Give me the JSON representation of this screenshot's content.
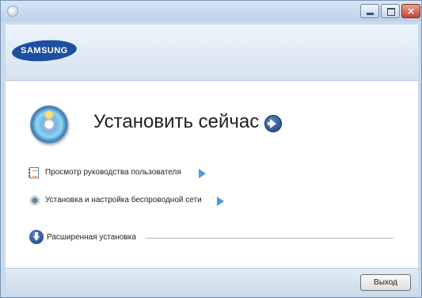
{
  "window": {
    "controls": {
      "close_symbol": "×"
    }
  },
  "header": {
    "logo_text": "SAMSUNG"
  },
  "main": {
    "install_now_label": "Установить сейчас",
    "links": [
      {
        "label": "Просмотр руководства пользователя",
        "icon": "document-icon"
      },
      {
        "label": "Установка и настройка беспроводной сети",
        "icon": "wireless-network-icon"
      }
    ],
    "advanced_label": "Расширенная установка"
  },
  "footer": {
    "exit_label": "Выход"
  },
  "colors": {
    "brand_blue": "#1d4fa3",
    "accent_blue": "#4b9be2",
    "window_frame": "#c9daec"
  }
}
